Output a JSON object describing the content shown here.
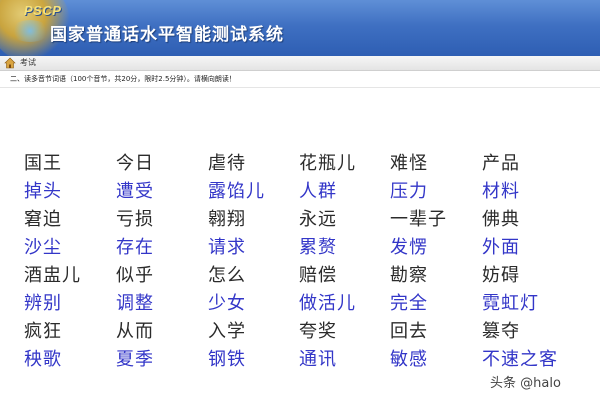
{
  "header": {
    "logo": "PSCP",
    "title": "国家普通话水平智能测试系统"
  },
  "nav": {
    "label": "考试"
  },
  "instructions": "二、读多音节词语（100个音节，共20分，限时2.5分钟）。请横向朗读！",
  "rows": [
    {
      "style": "dark",
      "words": [
        "国王",
        "今日",
        "虐待",
        "花瓶儿",
        "难怪",
        "产品"
      ]
    },
    {
      "style": "blue",
      "words": [
        "掉头",
        "遭受",
        "露馅儿",
        "人群",
        "压力",
        "材料"
      ]
    },
    {
      "style": "dark",
      "words": [
        "窘迫",
        "亏损",
        "翱翔",
        "永远",
        "一辈子",
        "佛典"
      ]
    },
    {
      "style": "blue",
      "words": [
        "沙尘",
        "存在",
        "请求",
        "累赘",
        "发愣",
        "外面"
      ]
    },
    {
      "style": "dark",
      "words": [
        "酒盅儿",
        "似乎",
        "怎么",
        "赔偿",
        "勘察",
        "妨碍"
      ]
    },
    {
      "style": "blue",
      "words": [
        "辨别",
        "调整",
        "少女",
        "做活儿",
        "完全",
        "霓虹灯"
      ]
    },
    {
      "style": "dark",
      "words": [
        "疯狂",
        "从而",
        "入学",
        "夸奖",
        "回去",
        "篡夺"
      ]
    },
    {
      "style": "blue",
      "words": [
        "秧歌",
        "夏季",
        "钢铁",
        "通讯",
        "敏感",
        "不速之客"
      ]
    }
  ],
  "watermark": "头条 @halo",
  "colors": {
    "header": "#3f70c2",
    "blue_text": "#3336c8",
    "dark_text": "#2b2b2b"
  }
}
